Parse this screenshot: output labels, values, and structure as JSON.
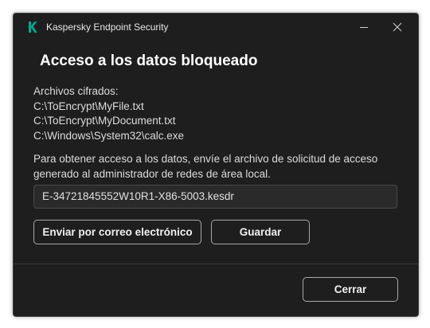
{
  "window": {
    "app_title": "Kaspersky Endpoint Security",
    "logo_letter": "K",
    "icons": {
      "logo": "kaspersky-logo",
      "minimize": "minimize-icon",
      "close": "close-icon"
    }
  },
  "dialog": {
    "heading": "Acceso a los datos bloqueado",
    "files_label": "Archivos cifrados:",
    "files": [
      "C:\\ToEncrypt\\MyFile.txt",
      "C:\\ToEncrypt\\MyDocument.txt",
      "C:\\Windows\\System32\\calc.exe"
    ],
    "instructions_line1": "Para obtener acceso a los datos, envíe el archivo de solicitud de acceso",
    "instructions_line2": "generado al administrador de redes de área local.",
    "request_file": "E-34721845552W10R1-X86-5003.kesdr",
    "email_button": "Enviar por correo electrónico",
    "save_button": "Guardar",
    "close_button": "Cerrar"
  },
  "colors": {
    "window_bg": "#1e1e1e",
    "logo_green": "#00a88e",
    "field_bg": "#2a2a2a",
    "button_border": "#a9a9a9"
  }
}
